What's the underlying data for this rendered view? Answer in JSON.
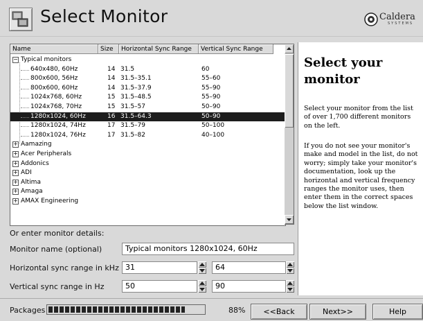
{
  "header": {
    "title": "Select Monitor",
    "logo_text": "Caldera",
    "logo_sub": "SYSTEMS"
  },
  "list": {
    "columns": [
      "Name",
      "Size",
      "Horizontal Sync Range",
      "Vertical Sync Range"
    ],
    "group_expanded": "Typical monitors",
    "monitors": [
      {
        "name": "640x480, 60Hz",
        "size": "14",
        "hsync": "31.5",
        "vsync": "60"
      },
      {
        "name": "800x600, 56Hz",
        "size": "14",
        "hsync": "31.5–35.1",
        "vsync": "55–60"
      },
      {
        "name": "800x600, 60Hz",
        "size": "14",
        "hsync": "31.5–37.9",
        "vsync": "55–90"
      },
      {
        "name": "1024x768, 60Hz",
        "size": "15",
        "hsync": "31.5–48.5",
        "vsync": "55–90"
      },
      {
        "name": "1024x768, 70Hz",
        "size": "15",
        "hsync": "31.5–57",
        "vsync": "50–90"
      },
      {
        "name": "1280x1024, 60Hz",
        "size": "16",
        "hsync": "31.5–64.3",
        "vsync": "50–90",
        "selected": true
      },
      {
        "name": "1280x1024, 74Hz",
        "size": "17",
        "hsync": "31.5–79",
        "vsync": "50–100"
      },
      {
        "name": "1280x1024, 76Hz",
        "size": "17",
        "hsync": "31.5–82",
        "vsync": "40–100"
      }
    ],
    "collapsed_groups": [
      "Aamazing",
      "Acer Peripherals",
      "Addonics",
      "ADI",
      "Altima",
      "Amaga",
      "AMAX Engineering"
    ]
  },
  "help": {
    "title": "Select your monitor",
    "p1": "Select your monitor from the list of over 1,700 different monitors on the left.",
    "p2": "If you do not see your monitor's make and model in the list, do not worry; simply take your monitor's documentation, look up the horizontal and vertical frequency ranges the monitor uses, then enter them in the correct spaces below the list window."
  },
  "details": {
    "heading": "Or enter monitor details:",
    "name_label": "Monitor name (optional)",
    "name_value": "Typical monitors 1280x1024, 60Hz",
    "hsync_label": "Horizontal sync range in kHz",
    "hsync_min": "31",
    "hsync_max": "64",
    "vsync_label": "Vertical sync range in Hz",
    "vsync_min": "50",
    "vsync_max": "90"
  },
  "footer": {
    "packages_label": "Packages",
    "progress": 0.88,
    "progress_text": "88%",
    "back": "<<Back",
    "next": "Next>>",
    "help": "Help"
  },
  "colors": {
    "background": "#d9d9d9",
    "selection": "#1d1d1d",
    "progress_fill": "#222222"
  }
}
